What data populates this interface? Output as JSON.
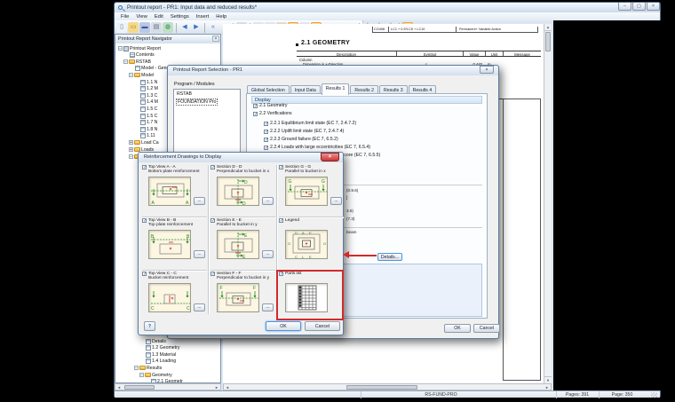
{
  "window": {
    "title": "Printout report - PR1: Input data and reduced results*",
    "buttons": [
      {
        "name": "minimize",
        "glyph": "–"
      },
      {
        "name": "maximize",
        "glyph": "▢"
      },
      {
        "name": "close",
        "glyph": "×"
      }
    ],
    "close_glyph": "×"
  },
  "menu": [
    "File",
    "View",
    "Edit",
    "Settings",
    "Insert",
    "Help"
  ],
  "toolbar": [
    {
      "n": "new-report",
      "g": "▯",
      "c": "#eef3f9",
      "f": "#5a7aa0"
    },
    {
      "n": "open",
      "g": "▭",
      "c": "#f5d98c",
      "f": "#9a7020"
    },
    {
      "n": "save",
      "g": "▬",
      "c": "#b9c8e6",
      "f": "#3a5a92"
    },
    {
      "n": "print",
      "g": "▤",
      "c": "#d7dde6",
      "f": "#5a6a7a"
    },
    {
      "n": "refresh",
      "g": "◍",
      "c": "#bfe0c8",
      "f": "#2a7a4a",
      "sep": true
    },
    {
      "n": "back",
      "g": "◀",
      "c": "",
      "f": "#3a6fd0"
    },
    {
      "n": "forward",
      "g": "▶",
      "c": "",
      "f": "#3a6fd0",
      "sep": true
    },
    {
      "n": "first-page",
      "g": "«",
      "c": "",
      "f": "#3a6fd0"
    },
    {
      "n": "last-page",
      "g": "»",
      "c": "",
      "f": "#3a6fd0",
      "sep": true
    },
    {
      "n": "printer",
      "g": "▤",
      "c": "#d7dde6",
      "f": "#5a6a7a",
      "sep": true
    },
    {
      "n": "zoom-out",
      "g": "−",
      "c": "#dfe6ee",
      "f": "#33506e"
    },
    {
      "n": "zoom-in",
      "g": "+",
      "c": "#dfe6ee",
      "f": "#33506e"
    },
    {
      "n": "color-picker",
      "g": "▾",
      "c": "#e8d8c0",
      "f": "#7a5a20"
    },
    {
      "n": "graphics",
      "g": "▣",
      "c": "#f9c87a",
      "f": "#b05a10",
      "sel": true
    },
    {
      "n": "zoom-window",
      "g": "◈",
      "c": "#dfe6ee",
      "f": "#33506e"
    },
    {
      "n": "report-pages",
      "g": "▰",
      "c": "#f9c87a",
      "f": "#b06a10",
      "sel": true
    },
    {
      "n": "page-1",
      "g": "▯",
      "c": "#f2f5f9",
      "f": "#8090a0"
    },
    {
      "n": "page-2",
      "g": "▯",
      "c": "#f2f5f9",
      "f": "#8090a0"
    },
    {
      "n": "page-3",
      "g": "▯",
      "c": "#f2f5f9",
      "f": "#8090a0",
      "sep": true
    },
    {
      "n": "tool-1",
      "g": "┼",
      "c": "#dfe6ee",
      "f": "#3a5a92"
    },
    {
      "n": "tool-2",
      "g": "┼",
      "c": "#dfe6ee",
      "f": "#3a5a92"
    },
    {
      "n": "tool-3",
      "g": "┼",
      "c": "#dfe6ee",
      "f": "#3a5a92",
      "sep": true
    },
    {
      "n": "settings",
      "g": "☼",
      "c": "#f9c87a",
      "f": "#b05a10",
      "sel": true
    }
  ],
  "navigator": {
    "title": "Printout Report Navigator",
    "tree_top": [
      {
        "i": 0,
        "t": "-",
        "ic": "report",
        "l": "Printout Report"
      },
      {
        "i": 1,
        "ic": "contents",
        "l": "Contents"
      },
      {
        "i": 1,
        "t": "-",
        "ic": "folder",
        "l": "RSTAB"
      },
      {
        "i": 2,
        "ic": "table",
        "l": "Model - General Data"
      },
      {
        "i": 2,
        "t": "-",
        "ic": "folder",
        "l": "Model"
      },
      {
        "i": 3,
        "ic": "table",
        "l": "1.1 N"
      },
      {
        "i": 3,
        "ic": "table",
        "l": "1.2 M"
      },
      {
        "i": 3,
        "ic": "table",
        "l": "1.3 C"
      },
      {
        "i": 3,
        "ic": "table",
        "l": "1.4 M"
      },
      {
        "i": 3,
        "ic": "table",
        "l": "1.5 C"
      },
      {
        "i": 3,
        "ic": "table",
        "l": "1.5 C"
      },
      {
        "i": 3,
        "ic": "table",
        "l": "1.7 N"
      },
      {
        "i": 3,
        "ic": "table",
        "l": "1.8 N"
      },
      {
        "i": 3,
        "ic": "table",
        "l": "1.11"
      },
      {
        "i": 2,
        "t": "+",
        "ic": "folder",
        "l": "Load Ca"
      },
      {
        "i": 2,
        "t": "+",
        "ic": "folder",
        "l": "Loads"
      },
      {
        "i": 2,
        "t": "-",
        "ic": "folder",
        "l": "Results"
      }
    ],
    "tree_bottom": [
      {
        "i": 4,
        "ic": "table",
        "l": "Details"
      },
      {
        "i": 4,
        "ic": "table",
        "l": "1.2 Geometry"
      },
      {
        "i": 4,
        "ic": "table",
        "l": "1.3 Material"
      },
      {
        "i": 4,
        "ic": "table",
        "l": "1.4 Loading"
      },
      {
        "i": 3,
        "t": "-",
        "ic": "folder",
        "l": "Results"
      },
      {
        "i": 4,
        "t": "-",
        "ic": "folder",
        "l": "Geometry"
      },
      {
        "i": 5,
        "ic": "table",
        "l": "2.1 Geometr"
      }
    ]
  },
  "document": {
    "combo": [
      "CO498",
      "LC1 + 0.5*LC5 + LC10",
      "Permanent+ Variable Action"
    ],
    "geometry": {
      "title": "2.1 GEOMETRY",
      "headers": [
        "Description",
        "Symbol",
        "Value",
        "Unit",
        "Message"
      ],
      "group": "Column",
      "row": {
        "d": "Dimension in x-Direction",
        "sym": "c",
        "sub": "x",
        "v": "0.440",
        "u": "m"
      }
    }
  },
  "sel": {
    "title": "Printout Report Selection - PR1",
    "pm_label": "Program / Modules",
    "programs": [
      "RSTAB",
      "FOUNDATION Pro"
    ],
    "selected_program": "FOUNDATION Pro",
    "tabs": [
      "Global Selection",
      "Input Data",
      "Results 1",
      "Results 2",
      "Results 3",
      "Results 4"
    ],
    "active_tab": "Results 1",
    "display_label": "Display",
    "checks": [
      {
        "lv": 0,
        "l": "2.1 Geometry"
      },
      {
        "lv": 0,
        "l": "2.2 Verifications"
      },
      {
        "lv": 1,
        "l": "2.2.1 Equilibrium limit state (EC 7, 2.4.7.2)"
      },
      {
        "lv": 1,
        "l": "2.2.2 Uplift limit state (EC 7, 2.4.7.4)"
      },
      {
        "lv": 1,
        "l": "2.2.3 Ground failure (EC 7, 6.5.2)"
      },
      {
        "lv": 1,
        "l": "2.2.4 Loads with large eccentricities (EC 7, 6.5.4)"
      },
      {
        "lv": 1,
        "l": "2.2.5 Highly eccentric loading in the core (EC 7, 6.5.5)"
      }
    ],
    "fragments": [
      "(0.9.6)",
      "]",
      "3.6)",
      "(7.3)",
      "beam"
    ],
    "details": "Details...",
    "ok": "OK",
    "cancel": "Cancel"
  },
  "reinf": {
    "title": "Reinforcement Drawings to Display",
    "more_label": "...",
    "cells": [
      {
        "t": "Top View A - A",
        "s": "Bottom plate reinforcement",
        "letter": "A",
        "type": "topA",
        "more": true
      },
      {
        "t": "Section D - D",
        "s": "Perpendicular to bucket in x",
        "letter": "D",
        "type": "secD",
        "more": true
      },
      {
        "t": "Section G - G",
        "s": "Parallel to bucket in x",
        "letter": "G",
        "type": "secG",
        "more": true
      },
      {
        "t": "Top View B - B",
        "s": "Top plate reinforcement",
        "letter": "B",
        "type": "topB",
        "more": true
      },
      {
        "t": "Section E - E",
        "s": "Parallel to bucket in y",
        "letter": "E",
        "type": "secE",
        "more": true
      },
      {
        "t": "Legend",
        "s": "",
        "type": "legend",
        "letters": [
          "D",
          "A",
          "E",
          "G",
          "G",
          "C",
          "L",
          "E"
        ]
      },
      {
        "t": "Top View C - C",
        "s": "Bucket reinforcement",
        "letter": "C",
        "type": "topC",
        "more": true
      },
      {
        "t": "Section F - F",
        "s": "Perpendicular to bucket in y",
        "letter": "F",
        "type": "secF",
        "more": true
      },
      {
        "t": "Parts list",
        "s": "",
        "type": "parts",
        "hl": true
      }
    ],
    "help_label": "?",
    "ok": "OK",
    "cancel": "Cancel"
  },
  "status": {
    "module": "RS-FUND-PRO",
    "pages": "Pages: 391",
    "page": "Page: 350"
  },
  "ui": {
    "scroll_left": "◄",
    "scroll_right": "►",
    "scroll_up": "▲",
    "scroll_down": "▼"
  },
  "colors": {
    "annotation_red": "#d22a2a",
    "preview_bg": "#fcf6e2",
    "green": "#1e8a1e",
    "accent_orange": "#f6a833"
  }
}
